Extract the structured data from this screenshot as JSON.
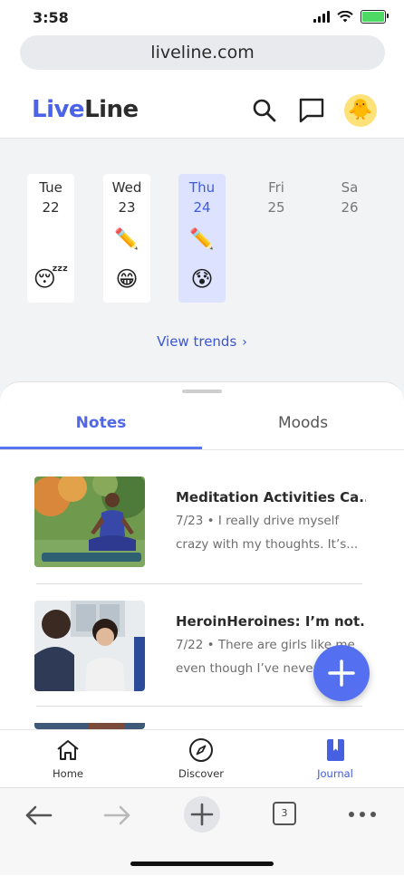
{
  "status": {
    "time": "3:58"
  },
  "browser": {
    "url": "liveline.com",
    "tab_count": "3"
  },
  "app": {
    "logo_part1": "Live",
    "logo_part2": "Line",
    "avatar_emoji": "🐥"
  },
  "week": [
    {
      "name": "Tue",
      "num": "22",
      "pencil": "",
      "mood": "😴"
    },
    {
      "name": "Wed",
      "num": "23",
      "pencil": "✏️",
      "mood": "😁"
    },
    {
      "name": "Thu",
      "num": "24",
      "pencil": "✏️",
      "mood": "😰"
    },
    {
      "name": "Fri",
      "num": "25",
      "pencil": "",
      "mood": ""
    },
    {
      "name": "Sa",
      "num": "26",
      "pencil": "",
      "mood": ""
    }
  ],
  "trends_label": "View trends",
  "tabs": {
    "notes": "Notes",
    "moods": "Moods"
  },
  "notes": [
    {
      "title": "Meditation Activities Ca...",
      "snippet": "7/23 • I really drive myself crazy with my thoughts. It’s..."
    },
    {
      "title": "HeroinHeroines: I’m not...",
      "snippet": "7/22 • There are girls like me even though I’ve never..."
    }
  ],
  "bottom_nav": {
    "home": "Home",
    "discover": "Discover",
    "journal": "Journal"
  },
  "colors": {
    "accent": "#4f67e8",
    "fab": "#5470f0",
    "active_day_bg": "#dde3ff"
  }
}
